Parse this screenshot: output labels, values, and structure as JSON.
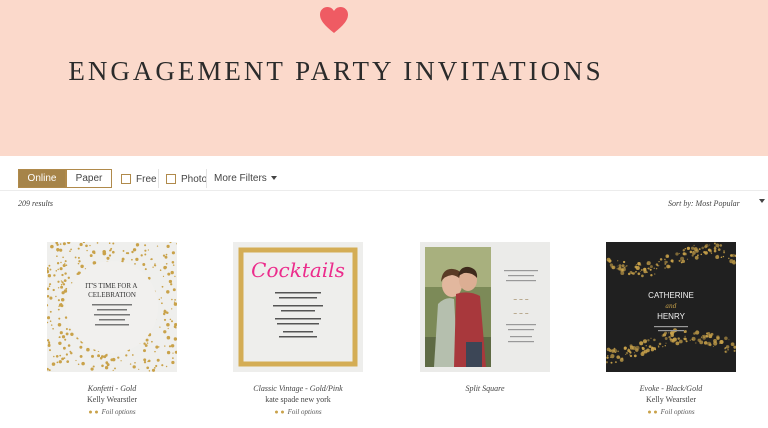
{
  "hero": {
    "title": "ENGAGEMENT PARTY INVITATIONS",
    "bg": "#fbd9cb",
    "heart_color": "#ef5b63"
  },
  "filters": {
    "online_label": "Online",
    "paper_label": "Paper",
    "free_label": "Free",
    "photo_label": "Photo",
    "more_label": "More Filters",
    "accent": "#a68449"
  },
  "results_count": "209 results",
  "sort_label": "Sort by: Most Popular",
  "cards": [
    {
      "name": "Konfetti - Gold",
      "designer": "Kelly Wearstler",
      "foil": "Foil options",
      "design": {
        "headline": "IT'S TIME FOR A CELEBRATION"
      }
    },
    {
      "name": "Classic Vintage - Gold/Pink",
      "designer": "kate spade new york",
      "foil": "Foil options",
      "design": {
        "headline": "Cocktails"
      }
    },
    {
      "name": "Split Square",
      "designer": "",
      "foil": "",
      "design": {}
    },
    {
      "name": "Evoke - Black/Gold",
      "designer": "Kelly Wearstler",
      "foil": "Foil options",
      "design": {
        "name1": "CATHERINE",
        "conj": "and",
        "name2": "HENRY"
      }
    }
  ]
}
